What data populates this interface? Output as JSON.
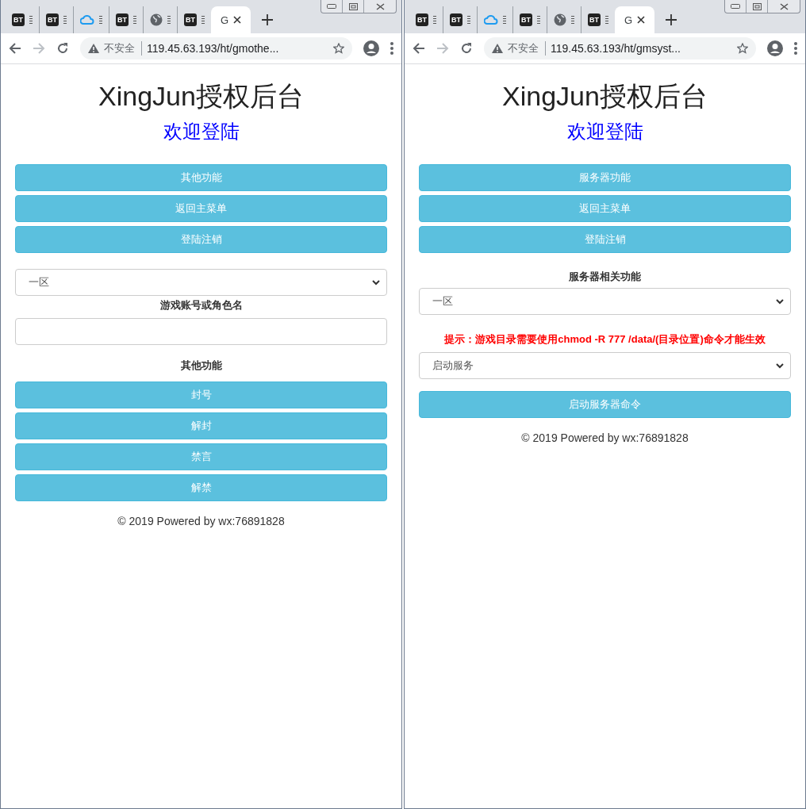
{
  "windows": [
    {
      "tabs": [
        {
          "kind": "badge",
          "badge": "BT",
          "selected": false
        },
        {
          "kind": "badge",
          "badge": "BT",
          "selected": false
        },
        {
          "kind": "cloud",
          "selected": false
        },
        {
          "kind": "badge",
          "badge": "BT",
          "selected": false
        },
        {
          "kind": "globe",
          "selected": false
        },
        {
          "kind": "badge",
          "badge": "BT",
          "selected": false
        },
        {
          "kind": "page",
          "label": "G",
          "selected": true
        }
      ],
      "address": {
        "security": "不安全",
        "url": "119.45.63.193/ht/gmothe..."
      },
      "page": {
        "title": "XingJun授权后台",
        "subtitle": "欢迎登陆",
        "blocks": [
          {
            "kind": "button",
            "text": "其他功能"
          },
          {
            "kind": "button",
            "text": "返回主菜单"
          },
          {
            "kind": "button",
            "text": "登陆注销"
          },
          {
            "kind": "select",
            "value": "一区"
          },
          {
            "kind": "label",
            "text": "游戏账号或角色名"
          },
          {
            "kind": "input"
          },
          {
            "kind": "label",
            "text": "其他功能"
          },
          {
            "kind": "button",
            "text": "封号"
          },
          {
            "kind": "button",
            "text": "解封"
          },
          {
            "kind": "button",
            "text": "禁言"
          },
          {
            "kind": "button",
            "text": "解禁"
          },
          {
            "kind": "footer",
            "text": "© 2019 Powered by wx:76891828"
          }
        ]
      }
    },
    {
      "tabs": [
        {
          "kind": "badge",
          "badge": "BT",
          "selected": false
        },
        {
          "kind": "badge",
          "badge": "BT",
          "selected": false
        },
        {
          "kind": "cloud",
          "selected": false
        },
        {
          "kind": "badge",
          "badge": "BT",
          "selected": false
        },
        {
          "kind": "globe",
          "selected": false
        },
        {
          "kind": "badge",
          "badge": "BT",
          "selected": false
        },
        {
          "kind": "page",
          "label": "G",
          "selected": true
        }
      ],
      "address": {
        "security": "不安全",
        "url": "119.45.63.193/ht/gmsyst..."
      },
      "page": {
        "title": "XingJun授权后台",
        "subtitle": "欢迎登陆",
        "blocks": [
          {
            "kind": "button",
            "text": "服务器功能"
          },
          {
            "kind": "button",
            "text": "返回主菜单"
          },
          {
            "kind": "button",
            "text": "登陆注销"
          },
          {
            "kind": "label",
            "text": "服务器相关功能"
          },
          {
            "kind": "select",
            "value": "一区"
          },
          {
            "kind": "notice",
            "text": "提示：游戏目录需要使用chmod -R 777 /data/(目录位置)命令才能生效"
          },
          {
            "kind": "select",
            "value": "启动服务"
          },
          {
            "kind": "button",
            "text": "启动服务器命令"
          },
          {
            "kind": "footer",
            "text": "© 2019 Powered by wx:76891828"
          }
        ]
      }
    }
  ]
}
